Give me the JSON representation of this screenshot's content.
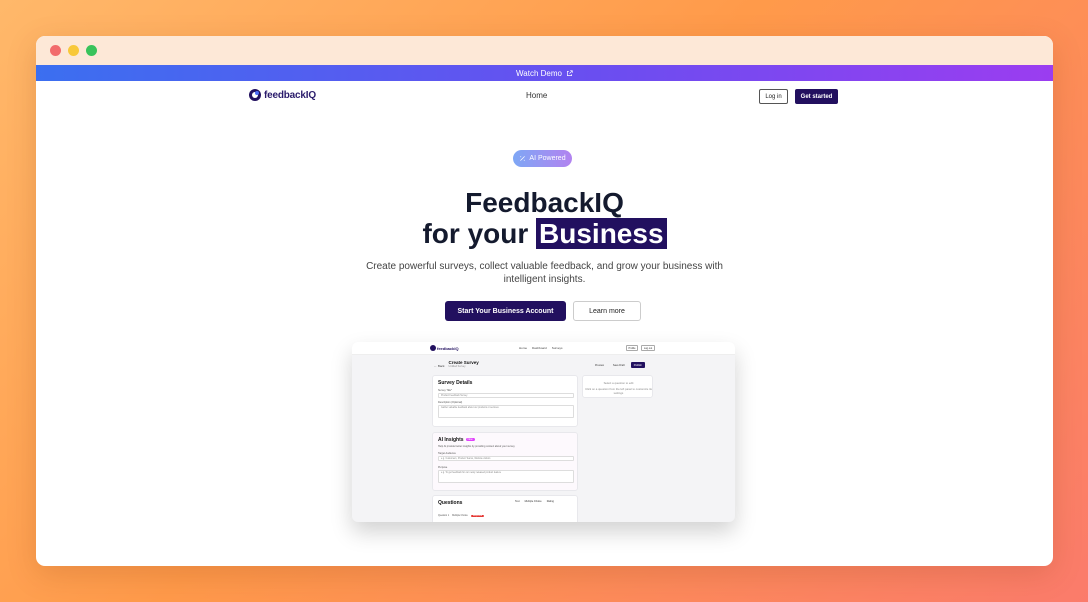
{
  "banner": {
    "label": "Watch Demo",
    "icon": "external-link-icon"
  },
  "nav": {
    "logo_text": "feedbackIQ",
    "home": "Home",
    "login": "Log in",
    "get_started": "Get started"
  },
  "hero": {
    "badge": "AI Powered",
    "title_line1": "FeedbackIQ",
    "title_line2_prefix": "for your",
    "title_highlight": "Business",
    "subtitle_line1": "Create powerful surveys, collect valuable feedback, and grow your business with",
    "subtitle_line2": "intelligent insights.",
    "cta_primary": "Start Your Business Account",
    "cta_secondary": "Learn more"
  },
  "preview": {
    "logo_text": "feedbackIQ",
    "nav_links": [
      "Home",
      "Dashboard",
      "Surveys"
    ],
    "nav_buttons": [
      "Profile",
      "Log out"
    ],
    "back": "Back",
    "page_title": "Create Survey",
    "page_subtitle": "Untitled Survey",
    "actions": [
      "Preview",
      "Save Draft",
      "Publish"
    ],
    "survey_details": {
      "heading": "Survey Details",
      "title_label": "Survey Title*",
      "title_value": "Product Feedback Survey",
      "desc_label": "Description (Optional)",
      "desc_value": "Gather valuable feedback about our products or services"
    },
    "ai_insights": {
      "heading": "AI Insights",
      "badge": "New",
      "desc": "Help AI provide better insights by providing context about your survey",
      "audience_label": "Target Audience",
      "audience_placeholder": "e.g. Customers, Product Teams, Website visitors",
      "purpose_label": "Purpose",
      "purpose_placeholder": "e.g. To get feedback for our newly released product feature"
    },
    "side_panel": {
      "line1": "Select a question to edit",
      "line2": "Click on a question from the left panel to customize its settings"
    },
    "questions": {
      "heading": "Questions",
      "tools": [
        "Text",
        "Multiple Choice",
        "Rating"
      ],
      "row_label": "Question 1",
      "row_value": "Multiple Choice",
      "row_tag": "Required"
    }
  }
}
